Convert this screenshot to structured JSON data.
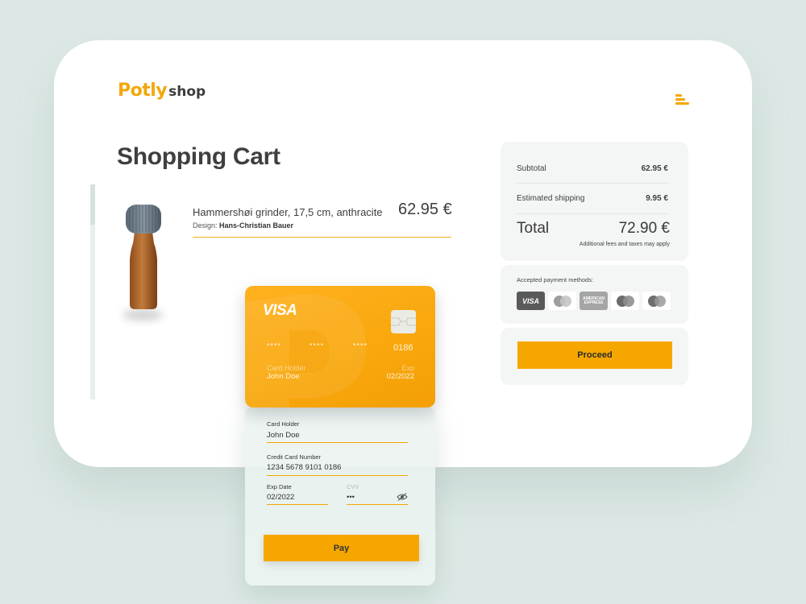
{
  "brand": {
    "name": "Potly",
    "suffix": "shop"
  },
  "page": {
    "title": "Shopping Cart"
  },
  "cart_item": {
    "name": "Hammershøi grinder, 17,5 cm, anthracite",
    "design_label": "Design:",
    "designer": "Hans-Christian Bauer",
    "price": "62.95 €"
  },
  "summary": {
    "subtotal_label": "Subtotal",
    "subtotal_value": "62.95 €",
    "shipping_label": "Estimated shipping",
    "shipping_value": "9.95 €",
    "total_label": "Total",
    "total_value": "72.90 €",
    "note": "Additional fees and taxes may apply"
  },
  "payment": {
    "title": "Accepted payment methods:",
    "methods": [
      {
        "icon": "visa-icon",
        "label": "VISA"
      },
      {
        "icon": "mastercard-icon",
        "label": ""
      },
      {
        "icon": "amex-icon",
        "label": "AMERICAN EXPRESS"
      },
      {
        "icon": "mastercard-icon",
        "label": ""
      },
      {
        "icon": "maestro-icon",
        "label": ""
      }
    ]
  },
  "proceed_label": "Proceed",
  "card": {
    "brand": "VISA",
    "dots": [
      "••••",
      "••••",
      "••••"
    ],
    "last4": "0186",
    "holder_label": "Card Holder",
    "holder_value": "John Doe",
    "exp_label": "Exp",
    "exp_value": "02/2022"
  },
  "form": {
    "holder_label": "Card Holder",
    "holder_value": "John Doe",
    "number_label": "Credit Card Number",
    "number_value": "1234 5678 9101 0186",
    "exp_label": "Exp Date",
    "exp_value": "02/2022",
    "cvv_label": "CVV",
    "cvv_value": "•••",
    "pay_label": "Pay"
  },
  "colors": {
    "accent": "#f5a700",
    "background": "#dce8e5",
    "panel": "#f3f6f5"
  }
}
